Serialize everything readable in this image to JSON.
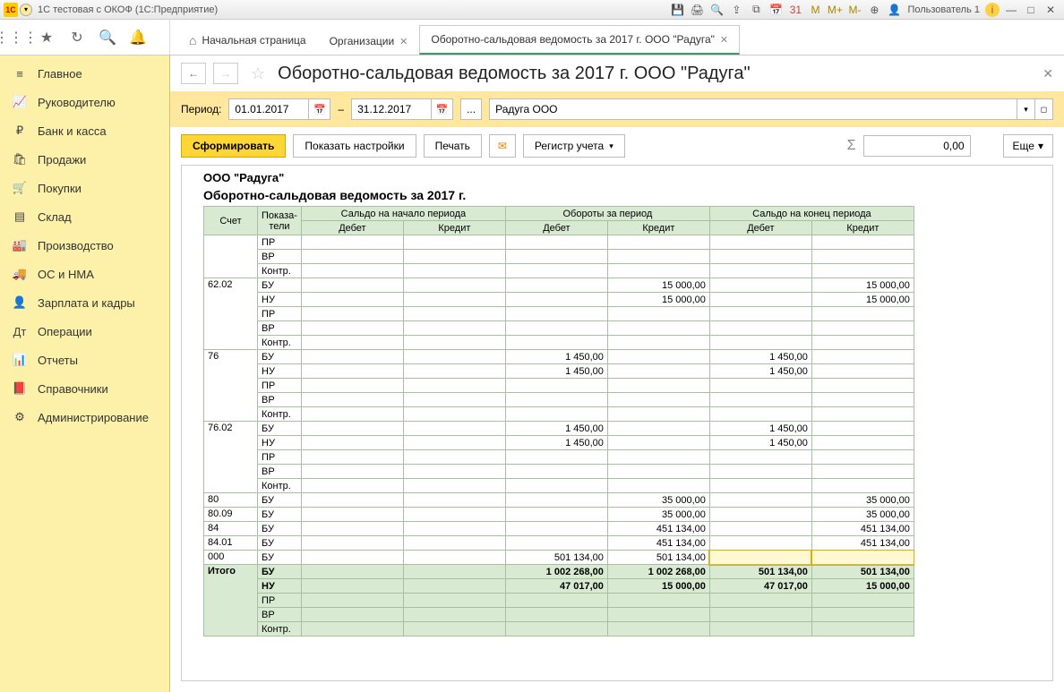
{
  "window": {
    "title": "1С тестовая с ОКОФ  (1С:Предприятие)",
    "user": "Пользователь 1"
  },
  "tabs": {
    "home": "Начальная страница",
    "t1": "Организации",
    "t2": "Оборотно-сальдовая ведомость за 2017 г. ООО \"Радуга\""
  },
  "sidebar": {
    "items": [
      {
        "icon": "≡",
        "label": "Главное"
      },
      {
        "icon": "📈",
        "label": "Руководителю"
      },
      {
        "icon": "₽",
        "label": "Банк и касса"
      },
      {
        "icon": "🛍",
        "label": "Продажи"
      },
      {
        "icon": "🛒",
        "label": "Покупки"
      },
      {
        "icon": "▤",
        "label": "Склад"
      },
      {
        "icon": "🏭",
        "label": "Производство"
      },
      {
        "icon": "🚚",
        "label": "ОС и НМА"
      },
      {
        "icon": "👤",
        "label": "Зарплата и кадры"
      },
      {
        "icon": "Дт",
        "label": "Операции"
      },
      {
        "icon": "📊",
        "label": "Отчеты"
      },
      {
        "icon": "📕",
        "label": "Справочники"
      },
      {
        "icon": "⚙",
        "label": "Администрирование"
      }
    ]
  },
  "page": {
    "title": "Оборотно-сальдовая ведомость за 2017 г. ООО \"Радуга\""
  },
  "filter": {
    "period_label": "Период:",
    "date_from": "01.01.2017",
    "date_to": "31.12.2017",
    "dash": "–",
    "dots": "...",
    "org": "Радуга ООО"
  },
  "actions": {
    "form": "Сформировать",
    "settings": "Показать настройки",
    "print": "Печать",
    "register": "Регистр учета",
    "sum": "0,00",
    "more": "Еще"
  },
  "report": {
    "org": "ООО \"Радуга\"",
    "title": "Оборотно-сальдовая ведомость за 2017 г.",
    "headers": {
      "account": "Счет",
      "indicators": "Показа-\nтели",
      "start": "Сальдо на начало периода",
      "turn": "Обороты за период",
      "end": "Сальдо на конец периода",
      "debit": "Дебет",
      "credit": "Кредит"
    },
    "indlabels": {
      "BU": "БУ",
      "NU": "НУ",
      "PR": "ПР",
      "VR": "ВР",
      "KONTR": "Контр."
    },
    "rows": [
      {
        "acc": "",
        "inds": [
          "ПР",
          "ВР",
          "Контр."
        ],
        "v": {}
      },
      {
        "acc": "62.02",
        "inds": [
          "БУ",
          "НУ",
          "ПР",
          "ВР",
          "Контр."
        ],
        "v": {
          "БУ": {
            "tc": "15 000,00",
            "ec": "15 000,00"
          },
          "НУ": {
            "tc": "15 000,00",
            "ec": "15 000,00"
          }
        }
      },
      {
        "acc": "76",
        "inds": [
          "БУ",
          "НУ",
          "ПР",
          "ВР",
          "Контр."
        ],
        "v": {
          "БУ": {
            "td": "1 450,00",
            "ed": "1 450,00"
          },
          "НУ": {
            "td": "1 450,00",
            "ed": "1 450,00"
          }
        }
      },
      {
        "acc": "76.02",
        "inds": [
          "БУ",
          "НУ",
          "ПР",
          "ВР",
          "Контр."
        ],
        "v": {
          "БУ": {
            "td": "1 450,00",
            "ed": "1 450,00"
          },
          "НУ": {
            "td": "1 450,00",
            "ed": "1 450,00"
          }
        }
      },
      {
        "acc": "80",
        "inds": [
          "БУ"
        ],
        "v": {
          "БУ": {
            "tc": "35 000,00",
            "ec": "35 000,00"
          }
        }
      },
      {
        "acc": "80.09",
        "inds": [
          "БУ"
        ],
        "v": {
          "БУ": {
            "tc": "35 000,00",
            "ec": "35 000,00"
          }
        }
      },
      {
        "acc": "84",
        "inds": [
          "БУ"
        ],
        "v": {
          "БУ": {
            "tc": "451 134,00",
            "ec": "451 134,00"
          }
        }
      },
      {
        "acc": "84.01",
        "inds": [
          "БУ"
        ],
        "v": {
          "БУ": {
            "tc": "451 134,00",
            "ec": "451 134,00"
          }
        }
      },
      {
        "acc": "000",
        "inds": [
          "БУ"
        ],
        "v": {
          "БУ": {
            "td": "501 134,00",
            "tc": "501 134,00"
          }
        },
        "hl": true
      }
    ],
    "total_label": "Итого",
    "totals": [
      {
        "ind": "БУ",
        "td": "1 002 268,00",
        "tc": "1 002 268,00",
        "ed": "501 134,00",
        "ec": "501 134,00",
        "bold": true
      },
      {
        "ind": "НУ",
        "td": "47 017,00",
        "tc": "15 000,00",
        "ed": "47 017,00",
        "ec": "15 000,00",
        "bold": true
      },
      {
        "ind": "ПР"
      },
      {
        "ind": "ВР"
      },
      {
        "ind": "Контр."
      }
    ]
  }
}
